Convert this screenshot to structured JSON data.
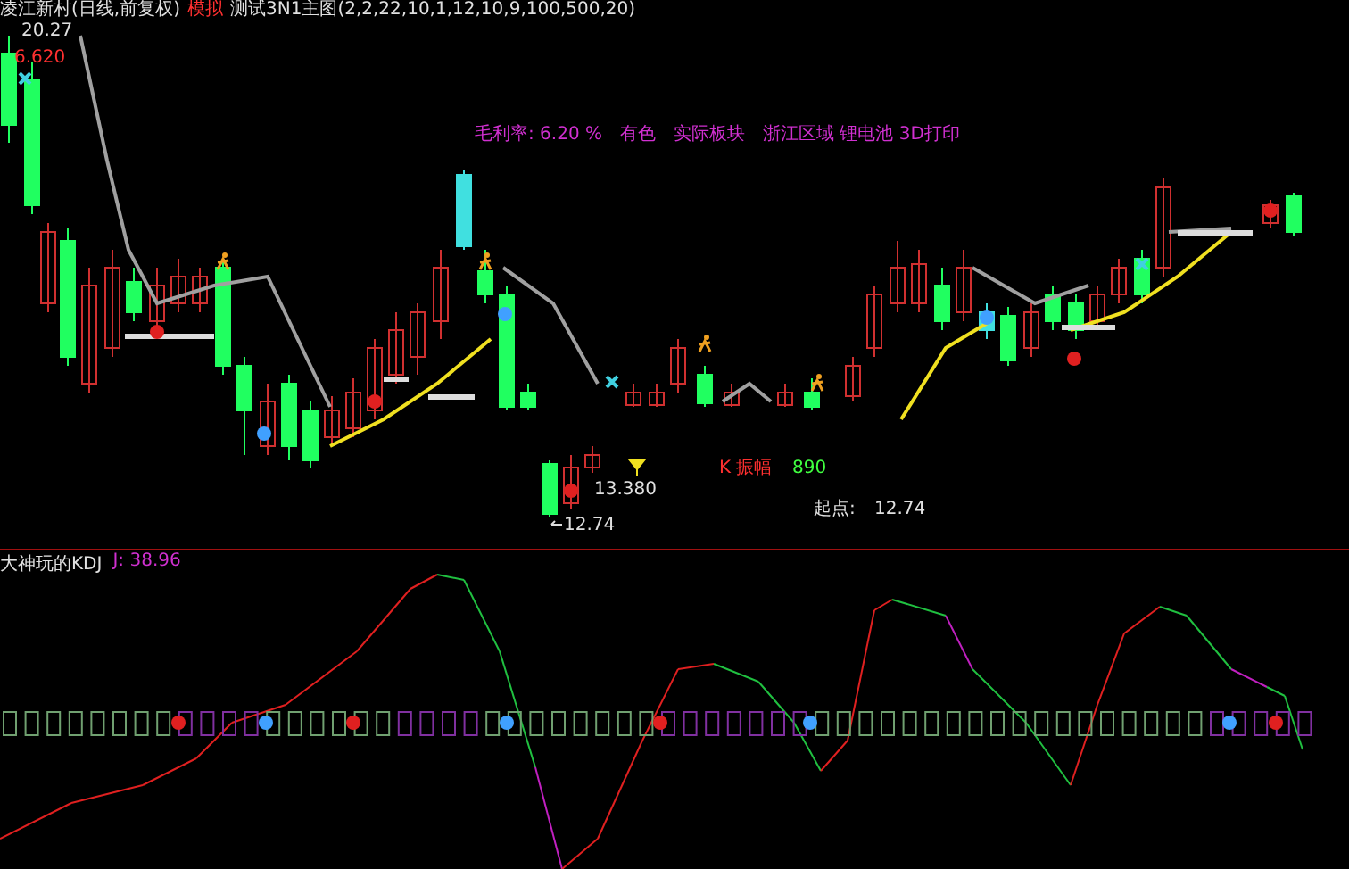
{
  "header": {
    "stock": "凌江新村(日线,前复权)",
    "mode": "模拟",
    "indicator": "测试3N1主图(2,2,22,10,1,12,10,9,100,500,20)"
  },
  "labels": [
    {
      "text": "20.27",
      "kind": "price"
    },
    {
      "text": "6.620",
      "kind": "alert"
    },
    {
      "text": "13.380",
      "kind": "price"
    },
    {
      "text": "12.74",
      "kind": "price"
    },
    {
      "text": "K 振幅",
      "kind": "alert"
    },
    {
      "text": "890",
      "kind": "good"
    },
    {
      "text": "起点:",
      "kind": "price"
    },
    {
      "text": "12.74",
      "kind": "price"
    }
  ],
  "info": [
    "毛利率: 6.20 %",
    "有色",
    "实际板块",
    "浙江区域 锂电池 3D打印"
  ],
  "kdj": {
    "title": "大神玩的KDJ",
    "reading": "J: 38.96"
  }
}
